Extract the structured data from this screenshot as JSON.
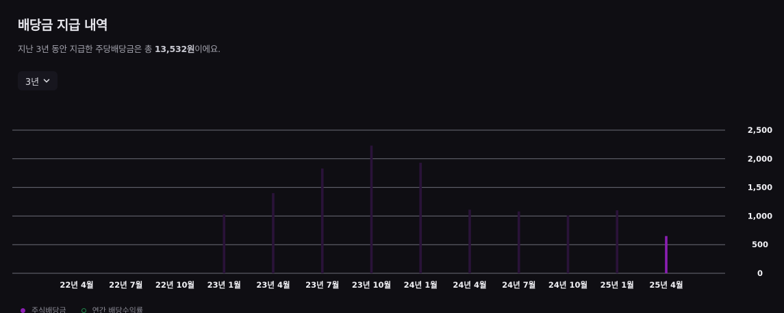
{
  "header": {
    "title": "배당금 지급 내역",
    "subtitle_prefix": "지난 3년 동안 지급한 주당배당금은 총 ",
    "subtitle_amount": "13,532원",
    "subtitle_suffix": "이에요."
  },
  "period_select": {
    "selected": "3년"
  },
  "legend": {
    "items": [
      {
        "label": "주식배당금"
      },
      {
        "label": "연간 배당수익률"
      }
    ]
  },
  "colors": {
    "bar_highlight": "#8b1fb3",
    "bar_dim": "#2a1339",
    "grid": "#6d6d78",
    "yield_ring": "#1f8a4c"
  },
  "chart_data": {
    "type": "bar",
    "categories": [
      "22년 4월",
      "22년 7월",
      "22년 10월",
      "23년 1월",
      "23년 4월",
      "23년 7월",
      "23년 10월",
      "24년 1월",
      "24년 4월",
      "24년 7월",
      "24년 10월",
      "25년 1월",
      "25년 4월"
    ],
    "series": [
      {
        "name": "주식배당금",
        "values": [
          0,
          0,
          0,
          1030,
          1400,
          1830,
          2230,
          1930,
          1110,
          1080,
          1010,
          1100,
          650
        ]
      }
    ],
    "highlight_index": 12,
    "yticks": [
      "0",
      "500",
      "1,000",
      "1,500",
      "2,000",
      "2,500"
    ],
    "ytick_values": [
      0,
      500,
      1000,
      1500,
      2000,
      2500
    ],
    "ylim": [
      0,
      2500
    ],
    "grid": true,
    "y_axis_side": "right",
    "legend_position": "bottom-left"
  }
}
